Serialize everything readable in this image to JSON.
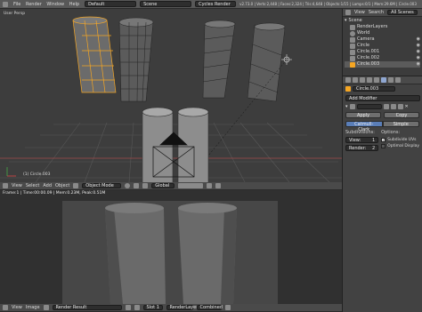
{
  "topbar": {
    "info_icon": "info-icon",
    "menu": [
      "File",
      "Render",
      "Window",
      "Help"
    ],
    "layout": "Default",
    "scene": "Scene",
    "engine": "Cycles Render",
    "stats": "v2.73.0 | Verts:2,448 | Faces:2,324 | Tris:4,648 | Objects:1/15 | Lamps:0/1 | Mem:29.6M | Circle.003"
  },
  "viewport": {
    "label": "User Persp",
    "object_label": "(1) Circle.003",
    "header": {
      "menu": [
        "View",
        "Select",
        "Add",
        "Object"
      ],
      "mode": "Object Mode",
      "pivot": "Global"
    }
  },
  "render_view": {
    "status": "Frame:1 | Time:00:00.09 | Mem:0.23M, Peak:0.51M",
    "header": {
      "menu": [
        "View",
        "Image"
      ],
      "image": "Render Result",
      "slot": "Slot 1",
      "layer": "RenderLayer",
      "pass": "Combined"
    }
  },
  "outliner": {
    "header": [
      "View",
      "Search",
      "All Scenes"
    ],
    "items": [
      {
        "label": "Scene",
        "indent": 0
      },
      {
        "label": "RenderLayers",
        "indent": 1
      },
      {
        "label": "World",
        "indent": 1
      },
      {
        "label": "Camera",
        "indent": 1
      },
      {
        "label": "Circle",
        "indent": 1
      },
      {
        "label": "Circle.001",
        "indent": 1
      },
      {
        "label": "Circle.002",
        "indent": 1
      },
      {
        "label": "Circle.003",
        "indent": 1
      }
    ]
  },
  "properties": {
    "object_name": "Circle.003",
    "add_modifier": "Add Modifier",
    "apply": "Apply",
    "copy": "Copy",
    "subdiv_type": {
      "catmull": "Catmull-Clark",
      "simple": "Simple"
    },
    "subdivisions_label": "Subdivisions:",
    "view_field": "View:",
    "view_value": "1",
    "render_field": "Render:",
    "render_value": "2",
    "options_label": "Options:",
    "subdivide_uvs": "Subdivide UVs",
    "optimal_display": "Optimal Display"
  },
  "colors": {
    "accent": "#5a7eb8",
    "selected": "#f5a623",
    "header_bg": "#585858",
    "viewport_bg": "#3d3d3d"
  }
}
